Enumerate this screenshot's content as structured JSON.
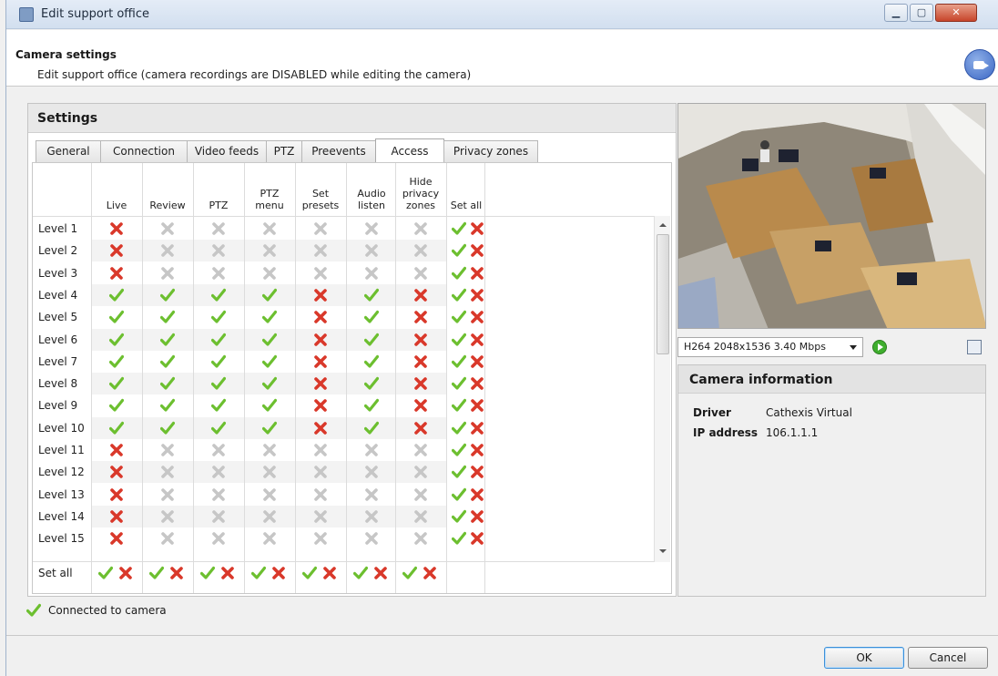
{
  "window": {
    "title": "Edit support office"
  },
  "header": {
    "title": "Camera settings",
    "subtitle": "Edit support office (camera recordings are DISABLED while editing the camera)"
  },
  "settings": {
    "title": "Settings",
    "tabs": [
      "General",
      "Connection",
      "Video feeds",
      "PTZ",
      "Preevents",
      "Access",
      "Privacy zones"
    ],
    "active_tab": "Access",
    "columns": [
      [
        "Live"
      ],
      [
        "Review"
      ],
      [
        "PTZ"
      ],
      [
        "PTZ",
        "menu"
      ],
      [
        "Set",
        "presets"
      ],
      [
        "Audio",
        "listen"
      ],
      [
        "Hide",
        "privacy",
        "zones"
      ]
    ],
    "set_all_label": "Set all",
    "rows": [
      {
        "label": "Level 1",
        "cells": [
          "deny-red",
          "deny-grey",
          "deny-grey",
          "deny-grey",
          "deny-grey",
          "deny-grey",
          "deny-grey"
        ]
      },
      {
        "label": "Level 2",
        "cells": [
          "deny-red",
          "deny-grey",
          "deny-grey",
          "deny-grey",
          "deny-grey",
          "deny-grey",
          "deny-grey"
        ]
      },
      {
        "label": "Level 3",
        "cells": [
          "deny-red",
          "deny-grey",
          "deny-grey",
          "deny-grey",
          "deny-grey",
          "deny-grey",
          "deny-grey"
        ]
      },
      {
        "label": "Level 4",
        "cells": [
          "allow",
          "allow",
          "allow",
          "allow",
          "deny-red",
          "allow",
          "deny-red"
        ]
      },
      {
        "label": "Level 5",
        "cells": [
          "allow",
          "allow",
          "allow",
          "allow",
          "deny-red",
          "allow",
          "deny-red"
        ]
      },
      {
        "label": "Level 6",
        "cells": [
          "allow",
          "allow",
          "allow",
          "allow",
          "deny-red",
          "allow",
          "deny-red"
        ]
      },
      {
        "label": "Level 7",
        "cells": [
          "allow",
          "allow",
          "allow",
          "allow",
          "deny-red",
          "allow",
          "deny-red"
        ]
      },
      {
        "label": "Level 8",
        "cells": [
          "allow",
          "allow",
          "allow",
          "allow",
          "deny-red",
          "allow",
          "deny-red"
        ]
      },
      {
        "label": "Level 9",
        "cells": [
          "allow",
          "allow",
          "allow",
          "allow",
          "deny-red",
          "allow",
          "deny-red"
        ]
      },
      {
        "label": "Level 10",
        "cells": [
          "allow",
          "allow",
          "allow",
          "allow",
          "deny-red",
          "allow",
          "deny-red"
        ]
      },
      {
        "label": "Level 11",
        "cells": [
          "deny-red",
          "deny-grey",
          "deny-grey",
          "deny-grey",
          "deny-grey",
          "deny-grey",
          "deny-grey"
        ]
      },
      {
        "label": "Level 12",
        "cells": [
          "deny-red",
          "deny-grey",
          "deny-grey",
          "deny-grey",
          "deny-grey",
          "deny-grey",
          "deny-grey"
        ]
      },
      {
        "label": "Level 13",
        "cells": [
          "deny-red",
          "deny-grey",
          "deny-grey",
          "deny-grey",
          "deny-grey",
          "deny-grey",
          "deny-grey"
        ]
      },
      {
        "label": "Level 14",
        "cells": [
          "deny-red",
          "deny-grey",
          "deny-grey",
          "deny-grey",
          "deny-grey",
          "deny-grey",
          "deny-grey"
        ]
      },
      {
        "label": "Level 15",
        "cells": [
          "deny-red",
          "deny-grey",
          "deny-grey",
          "deny-grey",
          "deny-grey",
          "deny-grey",
          "deny-grey"
        ]
      }
    ],
    "set_all_row_label": "Set all"
  },
  "status": {
    "text": "Connected to camera"
  },
  "video": {
    "feed": "H264 2048x1536 3.40 Mbps"
  },
  "camera_info": {
    "title": "Camera information",
    "fields": [
      {
        "key": "Driver",
        "value": "Cathexis Virtual"
      },
      {
        "key": "IP address",
        "value": "106.1.1.1"
      }
    ]
  },
  "footer": {
    "ok": "OK",
    "cancel": "Cancel"
  },
  "colors": {
    "allow": "#6cbf2f",
    "deny_red": "#d9382a",
    "deny_grey": "#c6c6c6",
    "accent": "#3b8fd9"
  }
}
